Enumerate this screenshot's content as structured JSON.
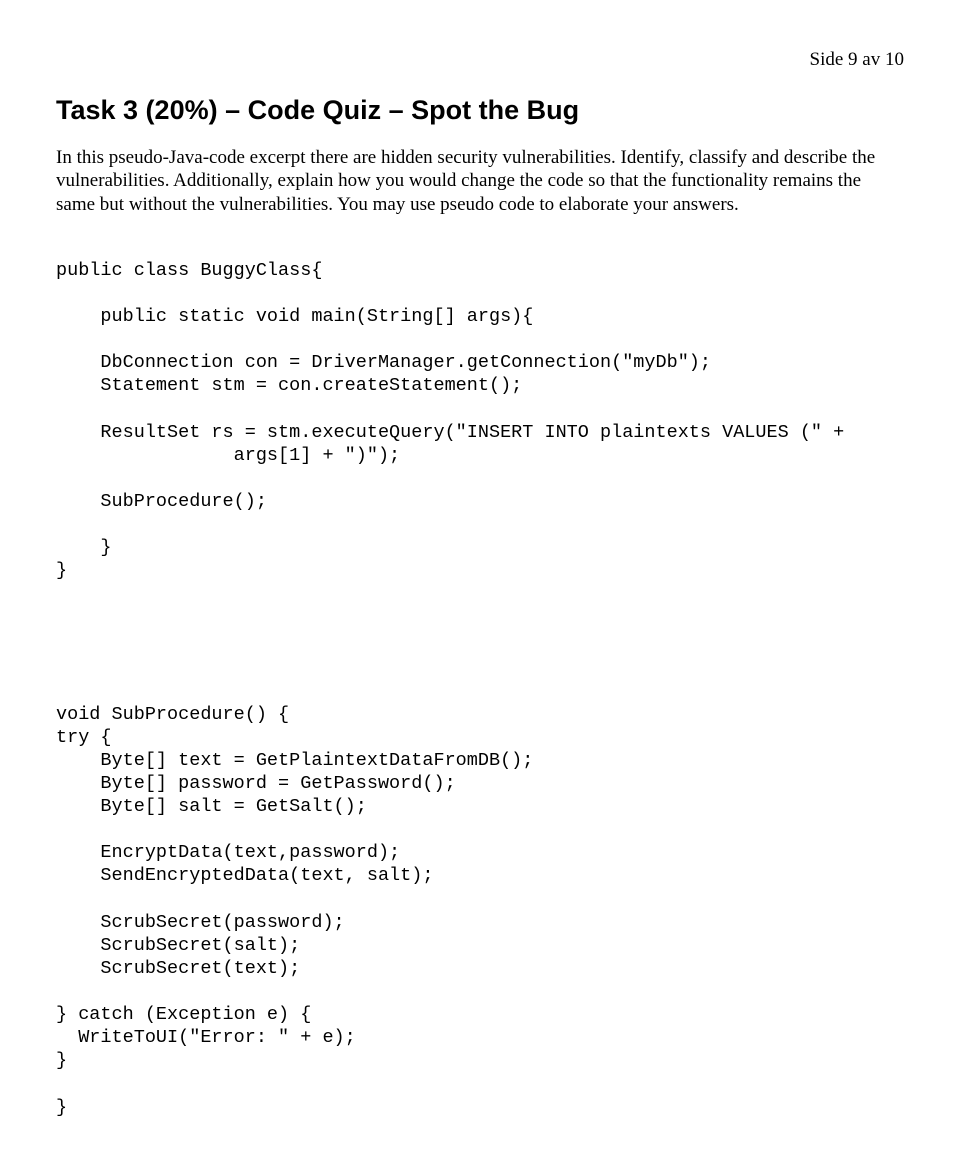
{
  "page_number": "Side 9 av 10",
  "title": "Task 3 (20%) – Code Quiz – Spot the Bug",
  "intro": "In this pseudo-Java-code excerpt there are hidden security vulnerabilities. Identify, classify and describe the vulnerabilities. Additionally, explain how you would change the code so that the functionality remains the same but without the vulnerabilities. You may use pseudo code to elaborate your answers.",
  "code_block_1": "public class BuggyClass{\n\n    public static void main(String[] args){\n\n    DbConnection con = DriverManager.getConnection(\"myDb\");\n    Statement stm = con.createStatement();\n\n    ResultSet rs = stm.executeQuery(\"INSERT INTO plaintexts VALUES (\" +\n                args[1] + \")\");\n\n    SubProcedure();\n\n    }\n}",
  "code_block_2": "void SubProcedure() {\ntry {\n    Byte[] text = GetPlaintextDataFromDB();\n    Byte[] password = GetPassword();\n    Byte[] salt = GetSalt();\n\n    EncryptData(text,password);\n    SendEncryptedData(text, salt);\n\n    ScrubSecret(password);\n    ScrubSecret(salt);\n    ScrubSecret(text);\n\n} catch (Exception e) {\n  WriteToUI(\"Error: \" + e);\n}\n\n}"
}
